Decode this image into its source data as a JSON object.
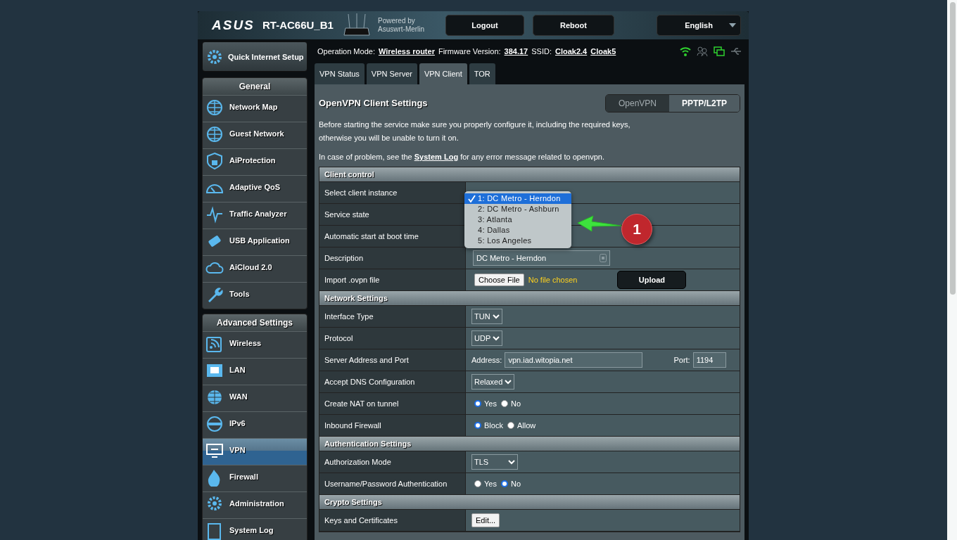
{
  "header": {
    "logo": "ASUS",
    "model": "RT-AC66U_B1",
    "powered_by": "Powered by",
    "firmware_name": "Asuswrt-Merlin",
    "buttons": [
      "Logout",
      "Reboot"
    ],
    "language": "English"
  },
  "sidebar": {
    "quick_setup": "Quick Internet Setup",
    "sections": [
      {
        "title": "General",
        "items": [
          {
            "label": "Network Map",
            "selected": false
          },
          {
            "label": "Guest Network",
            "selected": false
          },
          {
            "label": "AiProtection",
            "selected": false
          },
          {
            "label": "Adaptive QoS",
            "selected": false
          },
          {
            "label": "Traffic Analyzer",
            "selected": false
          },
          {
            "label": "USB Application",
            "selected": false
          },
          {
            "label": "AiCloud 2.0",
            "selected": false
          },
          {
            "label": "Tools",
            "selected": false
          }
        ]
      },
      {
        "title": "Advanced Settings",
        "items": [
          {
            "label": "Wireless",
            "selected": false
          },
          {
            "label": "LAN",
            "selected": false
          },
          {
            "label": "WAN",
            "selected": false
          },
          {
            "label": "IPv6",
            "selected": false
          },
          {
            "label": "VPN",
            "selected": true
          },
          {
            "label": "Firewall",
            "selected": false
          },
          {
            "label": "Administration",
            "selected": false
          },
          {
            "label": "System Log",
            "selected": false
          }
        ]
      }
    ]
  },
  "info_bar": [
    {
      "label": "Operation Mode:",
      "links": [
        "Wireless router"
      ]
    },
    {
      "label": "Firmware Version:",
      "links": [
        "384.17"
      ]
    },
    {
      "label": "SSID:",
      "links": [
        "Cloak2.4",
        "Cloak5"
      ]
    }
  ],
  "tabs": [
    {
      "label": "VPN Status",
      "selected": false
    },
    {
      "label": "VPN Server",
      "selected": false
    },
    {
      "label": "VPN Client",
      "selected": true
    },
    {
      "label": "TOR",
      "selected": false
    }
  ],
  "content": {
    "title": "OpenVPN Client Settings",
    "modes": [
      {
        "label": "OpenVPN",
        "selected": true
      },
      {
        "label": "PPTP/L2TP",
        "selected": false
      }
    ],
    "intro": [
      "Before starting the service make sure you properly configure it, including the required keys,",
      "otherwise you will be unable to turn it on."
    ],
    "help": {
      "before": "In case of problem, see the",
      "link": "System Log",
      "after": "for any error message related to openvpn."
    }
  },
  "sections": [
    {
      "title": "Client control",
      "rows": [
        {
          "label": "Select client instance"
        },
        {
          "label": "Service state"
        },
        {
          "label": "Automatic start at boot time"
        },
        {
          "label": "Description",
          "control": {
            "kind": "text",
            "value": "DC Metro - Herndon"
          }
        },
        {
          "label": "Import .ovpn file",
          "control": {
            "kind": "file",
            "button": "Choose File",
            "status": "No file chosen",
            "action": "Upload"
          }
        }
      ]
    },
    {
      "title": "Network Settings",
      "rows": [
        {
          "label": "Interface Type",
          "control": {
            "kind": "select",
            "value": "TUN"
          }
        },
        {
          "label": "Protocol",
          "control": {
            "kind": "select",
            "value": "UDP"
          }
        },
        {
          "label": "Server Address and Port",
          "control": {
            "kind": "address",
            "address_label": "Address:",
            "address": "vpn.iad.witopia.net",
            "port_label": "Port:",
            "port": "1194"
          }
        },
        {
          "label": "Accept DNS Configuration",
          "control": {
            "kind": "select",
            "value": "Relaxed"
          }
        },
        {
          "label": "Create NAT on tunnel",
          "control": {
            "kind": "radio",
            "options": [
              {
                "label": "Yes",
                "selected": true
              },
              {
                "label": "No",
                "selected": false
              }
            ]
          }
        },
        {
          "label": "Inbound Firewall",
          "control": {
            "kind": "radio",
            "options": [
              {
                "label": "Block",
                "selected": true
              },
              {
                "label": "Allow",
                "selected": false
              }
            ]
          }
        }
      ]
    },
    {
      "title": "Authentication Settings",
      "rows": [
        {
          "label": "Authorization Mode",
          "control": {
            "kind": "select",
            "value": "TLS",
            "wide": true
          }
        },
        {
          "label": "Username/Password Authentication",
          "control": {
            "kind": "radio",
            "options": [
              {
                "label": "Yes",
                "selected": false
              },
              {
                "label": "No",
                "selected": true
              }
            ]
          }
        }
      ]
    },
    {
      "title": "Crypto Settings",
      "rows": [
        {
          "label": "Keys and Certificates",
          "control": {
            "kind": "button",
            "label": "Edit..."
          }
        }
      ]
    }
  ],
  "instance_menu": {
    "options": [
      {
        "label": "1: DC Metro - Herndon",
        "selected": true
      },
      {
        "label": "2: DC Metro - Ashburn",
        "selected": false
      },
      {
        "label": "3: Atlanta",
        "selected": false
      },
      {
        "label": "4: Dallas",
        "selected": false
      },
      {
        "label": "5: Los Angeles",
        "selected": false
      }
    ]
  },
  "callout": {
    "number": "1"
  }
}
